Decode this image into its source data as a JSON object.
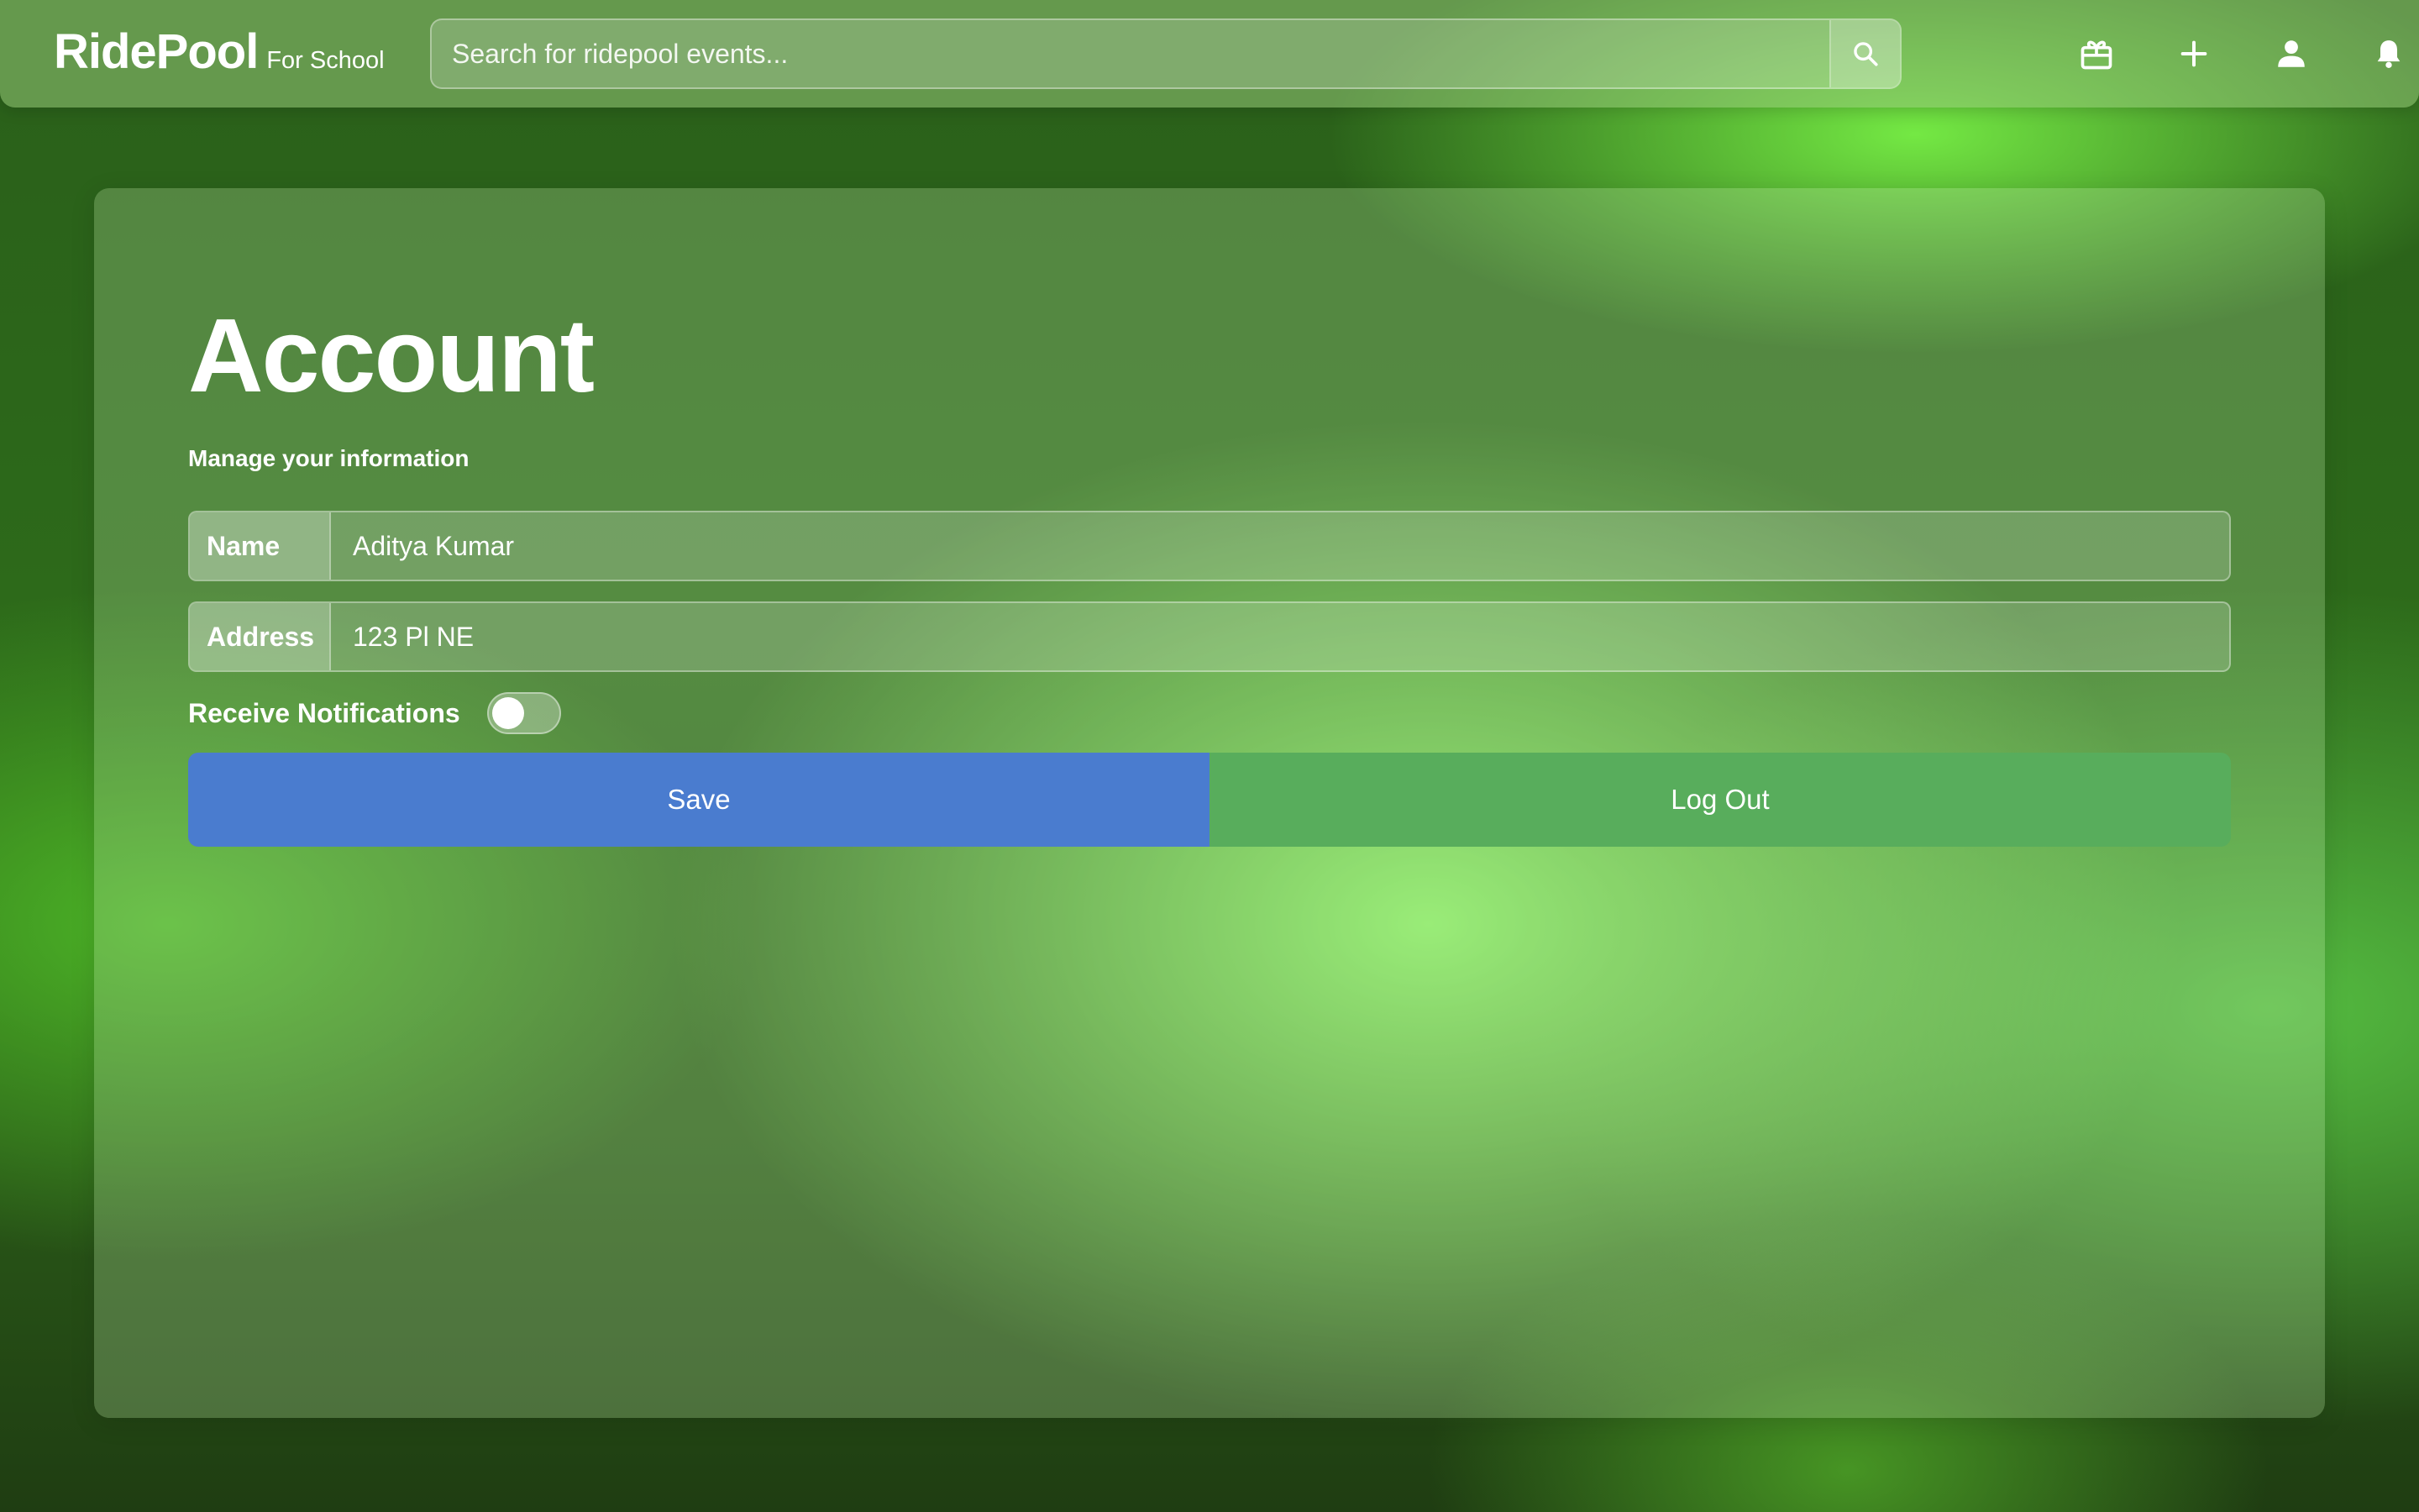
{
  "header": {
    "brand_name": "RidePool",
    "brand_sub": "For School",
    "search_placeholder": "Search for ridepool events...",
    "icons": [
      "search-icon",
      "gift-icon",
      "plus-icon",
      "user-icon",
      "bell-icon"
    ]
  },
  "account": {
    "title": "Account",
    "subtitle": "Manage your information",
    "fields": [
      {
        "label": "Name",
        "value": "Aditya Kumar"
      },
      {
        "label": "Address",
        "value": "123 Pl NE"
      }
    ],
    "notifications": {
      "label": "Receive Notifications",
      "enabled": false
    },
    "save_label": "Save",
    "logout_label": "Log Out"
  },
  "colors": {
    "save": "#4a7ccf",
    "logout": "#58ad5c",
    "background": "#2d6a1a"
  }
}
